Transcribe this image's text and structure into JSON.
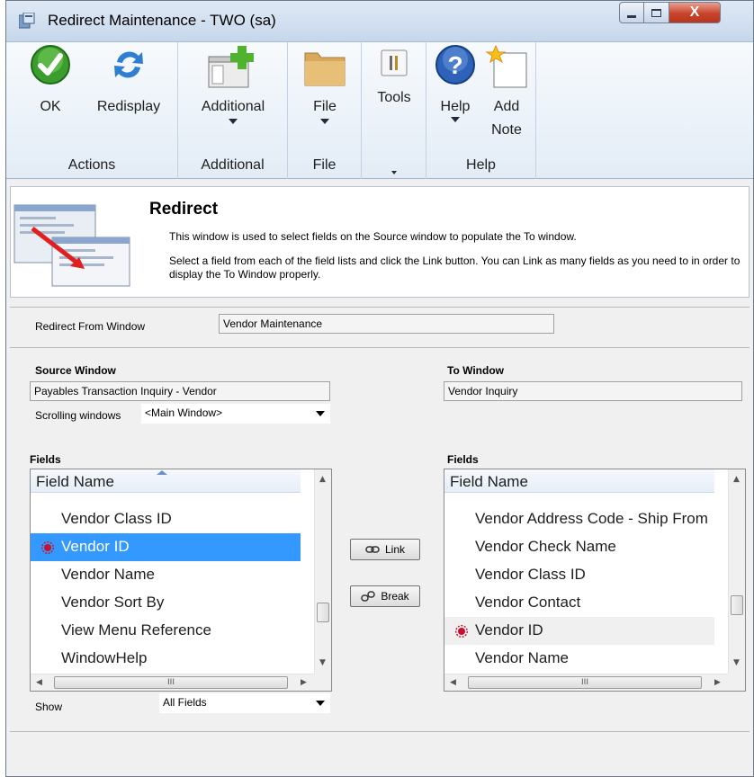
{
  "window": {
    "title": "Redirect Maintenance  -  TWO (sa)",
    "controls": {
      "close": "X"
    }
  },
  "ribbon": {
    "groups": [
      {
        "label": "Actions",
        "buttons": [
          {
            "label": "OK",
            "icon": "ok-check-icon"
          },
          {
            "label": "Redisplay",
            "icon": "redisplay-arrows-icon"
          }
        ]
      },
      {
        "label": "Additional",
        "buttons": [
          {
            "label": "Additional",
            "icon": "additional-window-icon"
          }
        ]
      },
      {
        "label": "File",
        "buttons": [
          {
            "label": "File",
            "icon": "folder-icon"
          }
        ]
      },
      {
        "label": "",
        "buttons": [
          {
            "label": "Tools",
            "icon": "tools-icon"
          }
        ]
      },
      {
        "label": "Help",
        "buttons": [
          {
            "label": "Help",
            "icon": "help-question-icon"
          },
          {
            "label": "Add Note",
            "line1": "Add",
            "line2": "Note",
            "icon": "add-note-icon"
          }
        ]
      }
    ]
  },
  "banner": {
    "title": "Redirect",
    "line1": "This window is used to select fields on the Source window to populate the To window.",
    "line2": "Select a field from each of the field lists and click the Link button.  You can Link as many fields as you need to in order to display the To Window properly."
  },
  "form": {
    "redirect_from_label": "Redirect From Window",
    "redirect_from_value": "Vendor Maintenance",
    "source_label": "Source Window",
    "source_value": "Payables Transaction Inquiry - Vendor",
    "scrolling_label": "Scrolling windows",
    "scrolling_value": "<Main Window>",
    "to_label": "To Window",
    "to_value": "Vendor Inquiry",
    "fields_label_left": "Fields",
    "fields_label_right": "Fields",
    "show_label": "Show",
    "show_value": "All Fields"
  },
  "left_list": {
    "header": "Field Name",
    "rows": [
      "Vendor Class ID",
      "Vendor ID",
      "Vendor Name",
      "Vendor Sort By",
      "View Menu Reference",
      "WindowHelp"
    ],
    "selected_index": 1,
    "linked_index": 1,
    "scroll_glyph": "III"
  },
  "right_list": {
    "header": "Field Name",
    "rows": [
      "Vendor Address Code - Ship From",
      "Vendor Check Name",
      "Vendor Class ID",
      "Vendor Contact",
      "Vendor ID",
      "Vendor Name"
    ],
    "highlight_index": 4,
    "linked_index": 4,
    "scroll_glyph": "III"
  },
  "buttons": {
    "link": "Link",
    "break": "Break"
  },
  "colors": {
    "selection": "#3399ff",
    "link_mark": "#c8102e",
    "close_button": "#c9442c"
  }
}
